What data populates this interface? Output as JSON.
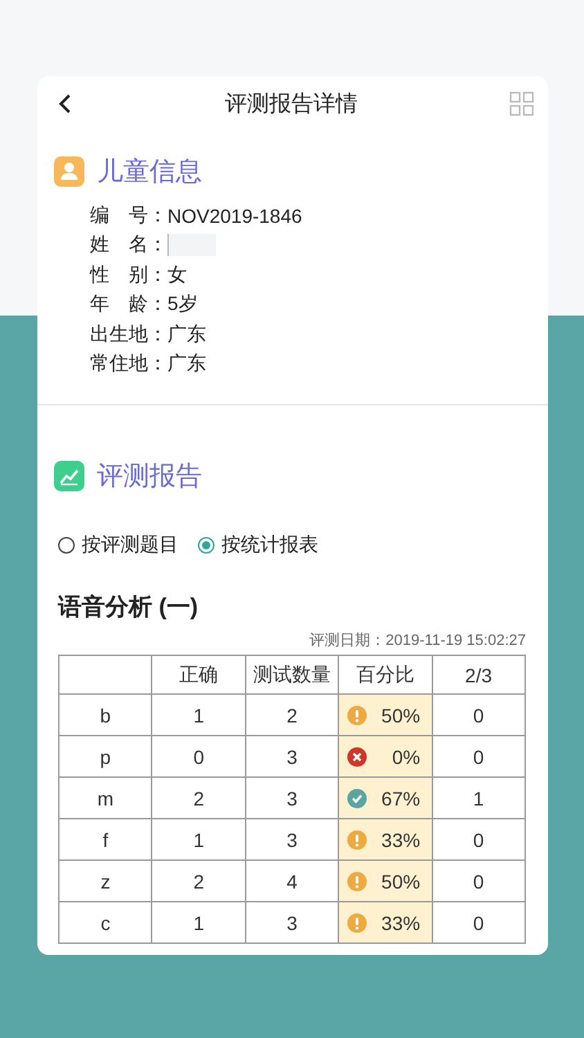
{
  "header": {
    "title": "评测报告详情"
  },
  "child_info": {
    "title": "儿童信息",
    "fields": [
      {
        "label": "编　号：",
        "value": "NOV2019-1846"
      },
      {
        "label": "姓　名：",
        "redacted": true
      },
      {
        "label": "性　别：",
        "value": "女"
      },
      {
        "label": "年　龄：",
        "value": "5岁"
      },
      {
        "label": "出生地：",
        "value": "广东"
      },
      {
        "label": "常住地：",
        "value": "广东"
      }
    ]
  },
  "report": {
    "title": "评测报告",
    "view_options": [
      {
        "label": "按评测题目",
        "selected": false
      },
      {
        "label": "按统计报表",
        "selected": true
      }
    ],
    "table_title": "语音分析 (一)",
    "date": "评测日期：2019-11-19 15:02:27",
    "table": {
      "columns": [
        "正确",
        "测试数量",
        "百分比",
        "2/3"
      ],
      "rows": [
        {
          "sound": "b",
          "correct": "1",
          "count": "2",
          "percent": "50%",
          "kind": "warning",
          "two_thirds": "0"
        },
        {
          "sound": "p",
          "correct": "0",
          "count": "3",
          "percent": "0%",
          "kind": "error",
          "two_thirds": "0"
        },
        {
          "sound": "m",
          "correct": "2",
          "count": "3",
          "percent": "67%",
          "kind": "ok",
          "two_thirds": "1"
        },
        {
          "sound": "f",
          "correct": "1",
          "count": "3",
          "percent": "33%",
          "kind": "warning",
          "two_thirds": "0"
        },
        {
          "sound": "z",
          "correct": "2",
          "count": "4",
          "percent": "50%",
          "kind": "warning",
          "two_thirds": "0"
        },
        {
          "sound": "c",
          "correct": "1",
          "count": "3",
          "percent": "33%",
          "kind": "warning",
          "two_thirds": "0"
        }
      ]
    }
  }
}
